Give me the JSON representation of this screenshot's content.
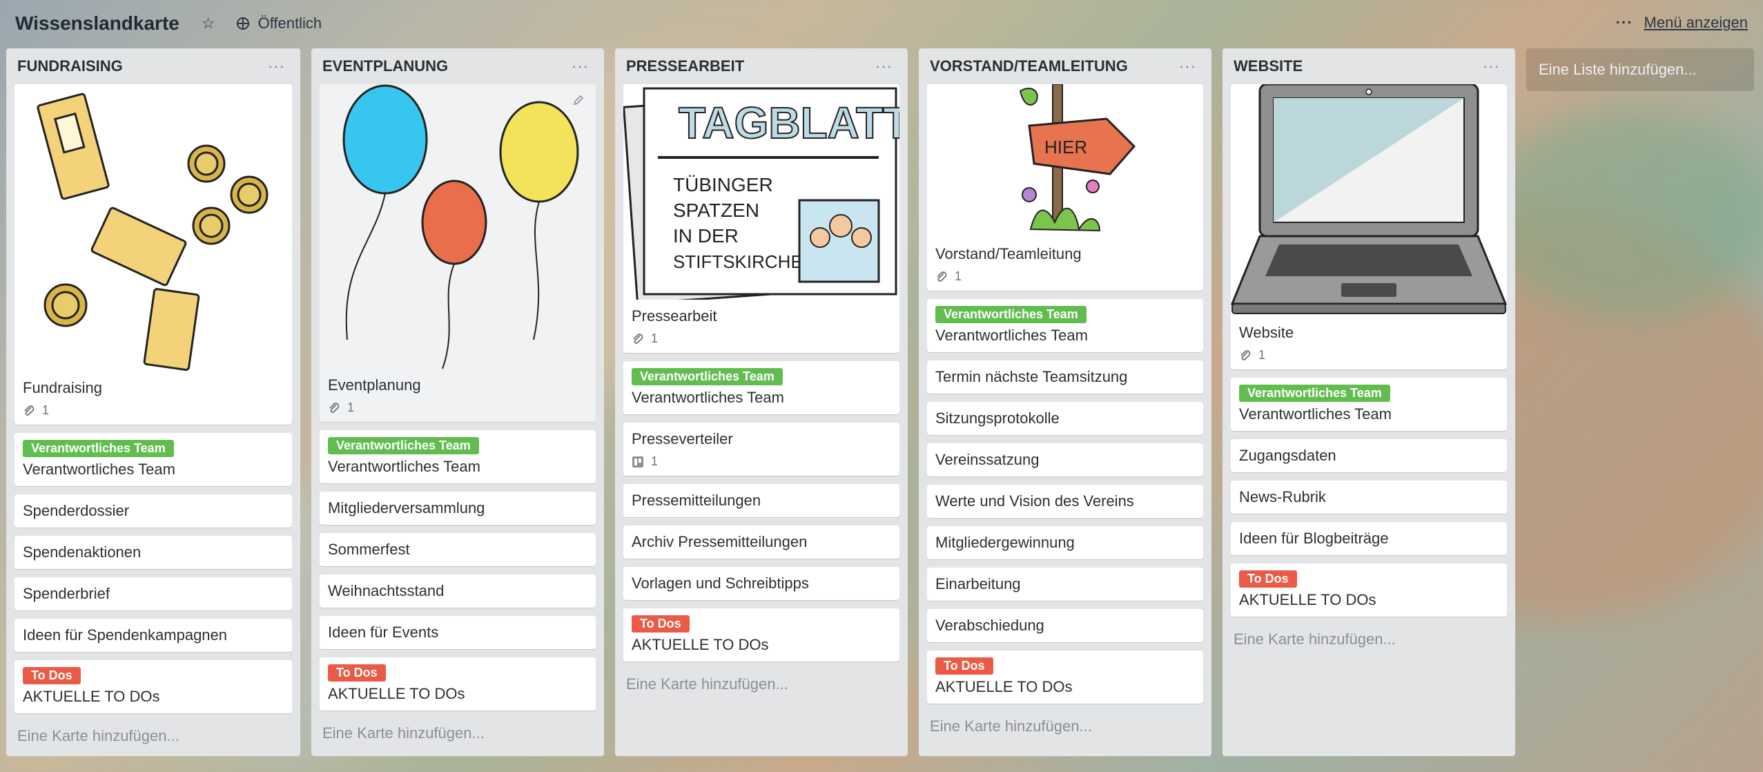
{
  "board": {
    "title": "Wissenslandkarte",
    "visibility": "Öffentlich",
    "menu_label": "Menü anzeigen"
  },
  "add_list_label": "Eine Liste hinzufügen...",
  "add_card_label": "Eine Karte hinzufügen...",
  "lists": [
    {
      "title": "FUNDRAISING",
      "cover_card": {
        "title": "Fundraising",
        "attachments": "1"
      },
      "team_card": {
        "label": "Verantwortliches Team",
        "title": "Verantwortliches Team"
      },
      "cards": [
        "Spenderdossier",
        "Spendenaktionen",
        "Spenderbrief",
        "Ideen für Spendenkampagnen"
      ],
      "todo_card": {
        "label": "To Dos",
        "title": "AKTUELLE TO DOs"
      }
    },
    {
      "title": "EVENTPLANUNG",
      "cover_card": {
        "title": "Eventplanung",
        "attachments": "1"
      },
      "team_card": {
        "label": "Verantwortliches Team",
        "title": "Verantwortliches Team"
      },
      "cards": [
        "Mitgliederversammlung",
        "Sommerfest",
        "Weihnachtsstand",
        "Ideen für Events"
      ],
      "todo_card": {
        "label": "To Dos",
        "title": "AKTUELLE TO DOs"
      }
    },
    {
      "title": "PRESSEARBEIT",
      "cover_card": {
        "title": "Pressearbeit",
        "attachments": "1",
        "cover_text": [
          "TAGBLATT",
          "TÜBINGER",
          "SPATZEN",
          "IN DER",
          "STIFTSKIRCHE"
        ]
      },
      "team_card": {
        "label": "Verantwortliches Team",
        "title": "Verantwortliches Team"
      },
      "presseverteiler": {
        "title": "Presseverteiler",
        "count": "1"
      },
      "cards": [
        "Pressemitteilungen",
        "Archiv Pressemitteilungen",
        "Vorlagen und Schreibtipps"
      ],
      "todo_card": {
        "label": "To Dos",
        "title": "AKTUELLE TO DOs"
      }
    },
    {
      "title": "VORSTAND/TEAMLEITUNG",
      "cover_card": {
        "title": "Vorstand/Teamleitung",
        "attachments": "1",
        "sign_text": "HIER"
      },
      "team_card": {
        "label": "Verantwortliches Team",
        "title": "Verantwortliches Team"
      },
      "cards": [
        "Termin nächste Teamsitzung",
        "Sitzungsprotokolle",
        "Vereinssatzung",
        "Werte und Vision des Vereins",
        "Mitgliedergewinnung",
        "Einarbeitung",
        "Verabschiedung"
      ],
      "todo_card": {
        "label": "To Dos",
        "title": "AKTUELLE TO DOs"
      }
    },
    {
      "title": "WEBSITE",
      "cover_card": {
        "title": "Website",
        "attachments": "1"
      },
      "team_card": {
        "label": "Verantwortliches Team",
        "title": "Verantwortliches Team"
      },
      "cards": [
        "Zugangsdaten",
        "News-Rubrik",
        "Ideen für Blogbeiträge"
      ],
      "todo_card": {
        "label": "To Dos",
        "title": "AKTUELLE TO DOs"
      }
    }
  ],
  "colors": {
    "label_green": "#61bd4f",
    "label_red": "#eb5a46",
    "list_bg": "#e2e4e6"
  }
}
